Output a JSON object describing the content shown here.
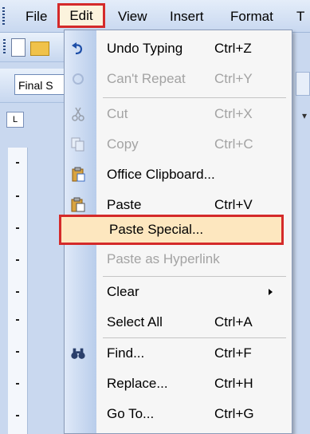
{
  "menubar": {
    "items": [
      {
        "label": "File"
      },
      {
        "label": "Edit"
      },
      {
        "label": "View"
      },
      {
        "label": "Insert"
      },
      {
        "label": "Format"
      },
      {
        "label": "T"
      }
    ]
  },
  "toolbar": {
    "style_value": "Final S",
    "ruler_corner": "L"
  },
  "edit_menu": {
    "items": [
      {
        "label": "Undo Typing",
        "shortcut": "Ctrl+Z",
        "icon": "undo-icon",
        "enabled": true
      },
      {
        "label": "Can't Repeat",
        "shortcut": "Ctrl+Y",
        "icon": "repeat-icon",
        "enabled": false
      },
      {
        "label": "Cut",
        "shortcut": "Ctrl+X",
        "icon": "cut-icon",
        "enabled": false
      },
      {
        "label": "Copy",
        "shortcut": "Ctrl+C",
        "icon": "copy-icon",
        "enabled": false
      },
      {
        "label": "Office Clipboard...",
        "shortcut": "",
        "icon": "clipboard-icon",
        "enabled": true
      },
      {
        "label": "Paste",
        "shortcut": "Ctrl+V",
        "icon": "paste-icon",
        "enabled": true
      },
      {
        "label": "Paste Special...",
        "shortcut": "",
        "icon": "",
        "enabled": true,
        "highlighted": true
      },
      {
        "label": "Paste as Hyperlink",
        "shortcut": "",
        "icon": "",
        "enabled": false
      },
      {
        "label": "Clear",
        "shortcut": "",
        "icon": "",
        "enabled": true,
        "submenu": true
      },
      {
        "label": "Select All",
        "shortcut": "Ctrl+A",
        "icon": "",
        "enabled": true
      },
      {
        "label": "Find...",
        "shortcut": "Ctrl+F",
        "icon": "binoculars-icon",
        "enabled": true
      },
      {
        "label": "Replace...",
        "shortcut": "Ctrl+H",
        "icon": "",
        "enabled": true
      },
      {
        "label": "Go To...",
        "shortcut": "Ctrl+G",
        "icon": "",
        "enabled": true
      }
    ]
  },
  "colors": {
    "highlight_border": "#d42a2a",
    "highlight_fill": "#fde7bf",
    "disabled_text": "#a3a3a3"
  }
}
